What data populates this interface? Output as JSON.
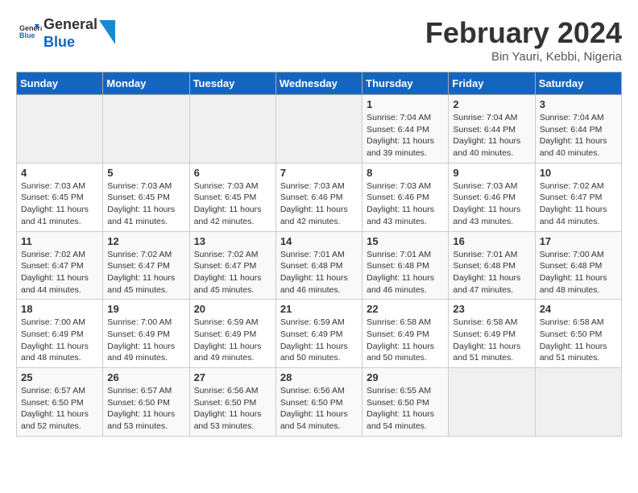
{
  "header": {
    "logo_general": "General",
    "logo_blue": "Blue",
    "month_title": "February 2024",
    "location": "Bin Yauri, Kebbi, Nigeria"
  },
  "weekdays": [
    "Sunday",
    "Monday",
    "Tuesday",
    "Wednesday",
    "Thursday",
    "Friday",
    "Saturday"
  ],
  "weeks": [
    [
      {
        "day": "",
        "sunrise": "",
        "sunset": "",
        "daylight": ""
      },
      {
        "day": "",
        "sunrise": "",
        "sunset": "",
        "daylight": ""
      },
      {
        "day": "",
        "sunrise": "",
        "sunset": "",
        "daylight": ""
      },
      {
        "day": "",
        "sunrise": "",
        "sunset": "",
        "daylight": ""
      },
      {
        "day": "1",
        "sunrise": "Sunrise: 7:04 AM",
        "sunset": "Sunset: 6:44 PM",
        "daylight": "Daylight: 11 hours and 39 minutes."
      },
      {
        "day": "2",
        "sunrise": "Sunrise: 7:04 AM",
        "sunset": "Sunset: 6:44 PM",
        "daylight": "Daylight: 11 hours and 40 minutes."
      },
      {
        "day": "3",
        "sunrise": "Sunrise: 7:04 AM",
        "sunset": "Sunset: 6:44 PM",
        "daylight": "Daylight: 11 hours and 40 minutes."
      }
    ],
    [
      {
        "day": "4",
        "sunrise": "Sunrise: 7:03 AM",
        "sunset": "Sunset: 6:45 PM",
        "daylight": "Daylight: 11 hours and 41 minutes."
      },
      {
        "day": "5",
        "sunrise": "Sunrise: 7:03 AM",
        "sunset": "Sunset: 6:45 PM",
        "daylight": "Daylight: 11 hours and 41 minutes."
      },
      {
        "day": "6",
        "sunrise": "Sunrise: 7:03 AM",
        "sunset": "Sunset: 6:45 PM",
        "daylight": "Daylight: 11 hours and 42 minutes."
      },
      {
        "day": "7",
        "sunrise": "Sunrise: 7:03 AM",
        "sunset": "Sunset: 6:46 PM",
        "daylight": "Daylight: 11 hours and 42 minutes."
      },
      {
        "day": "8",
        "sunrise": "Sunrise: 7:03 AM",
        "sunset": "Sunset: 6:46 PM",
        "daylight": "Daylight: 11 hours and 43 minutes."
      },
      {
        "day": "9",
        "sunrise": "Sunrise: 7:03 AM",
        "sunset": "Sunset: 6:46 PM",
        "daylight": "Daylight: 11 hours and 43 minutes."
      },
      {
        "day": "10",
        "sunrise": "Sunrise: 7:02 AM",
        "sunset": "Sunset: 6:47 PM",
        "daylight": "Daylight: 11 hours and 44 minutes."
      }
    ],
    [
      {
        "day": "11",
        "sunrise": "Sunrise: 7:02 AM",
        "sunset": "Sunset: 6:47 PM",
        "daylight": "Daylight: 11 hours and 44 minutes."
      },
      {
        "day": "12",
        "sunrise": "Sunrise: 7:02 AM",
        "sunset": "Sunset: 6:47 PM",
        "daylight": "Daylight: 11 hours and 45 minutes."
      },
      {
        "day": "13",
        "sunrise": "Sunrise: 7:02 AM",
        "sunset": "Sunset: 6:47 PM",
        "daylight": "Daylight: 11 hours and 45 minutes."
      },
      {
        "day": "14",
        "sunrise": "Sunrise: 7:01 AM",
        "sunset": "Sunset: 6:48 PM",
        "daylight": "Daylight: 11 hours and 46 minutes."
      },
      {
        "day": "15",
        "sunrise": "Sunrise: 7:01 AM",
        "sunset": "Sunset: 6:48 PM",
        "daylight": "Daylight: 11 hours and 46 minutes."
      },
      {
        "day": "16",
        "sunrise": "Sunrise: 7:01 AM",
        "sunset": "Sunset: 6:48 PM",
        "daylight": "Daylight: 11 hours and 47 minutes."
      },
      {
        "day": "17",
        "sunrise": "Sunrise: 7:00 AM",
        "sunset": "Sunset: 6:48 PM",
        "daylight": "Daylight: 11 hours and 48 minutes."
      }
    ],
    [
      {
        "day": "18",
        "sunrise": "Sunrise: 7:00 AM",
        "sunset": "Sunset: 6:49 PM",
        "daylight": "Daylight: 11 hours and 48 minutes."
      },
      {
        "day": "19",
        "sunrise": "Sunrise: 7:00 AM",
        "sunset": "Sunset: 6:49 PM",
        "daylight": "Daylight: 11 hours and 49 minutes."
      },
      {
        "day": "20",
        "sunrise": "Sunrise: 6:59 AM",
        "sunset": "Sunset: 6:49 PM",
        "daylight": "Daylight: 11 hours and 49 minutes."
      },
      {
        "day": "21",
        "sunrise": "Sunrise: 6:59 AM",
        "sunset": "Sunset: 6:49 PM",
        "daylight": "Daylight: 11 hours and 50 minutes."
      },
      {
        "day": "22",
        "sunrise": "Sunrise: 6:58 AM",
        "sunset": "Sunset: 6:49 PM",
        "daylight": "Daylight: 11 hours and 50 minutes."
      },
      {
        "day": "23",
        "sunrise": "Sunrise: 6:58 AM",
        "sunset": "Sunset: 6:49 PM",
        "daylight": "Daylight: 11 hours and 51 minutes."
      },
      {
        "day": "24",
        "sunrise": "Sunrise: 6:58 AM",
        "sunset": "Sunset: 6:50 PM",
        "daylight": "Daylight: 11 hours and 51 minutes."
      }
    ],
    [
      {
        "day": "25",
        "sunrise": "Sunrise: 6:57 AM",
        "sunset": "Sunset: 6:50 PM",
        "daylight": "Daylight: 11 hours and 52 minutes."
      },
      {
        "day": "26",
        "sunrise": "Sunrise: 6:57 AM",
        "sunset": "Sunset: 6:50 PM",
        "daylight": "Daylight: 11 hours and 53 minutes."
      },
      {
        "day": "27",
        "sunrise": "Sunrise: 6:56 AM",
        "sunset": "Sunset: 6:50 PM",
        "daylight": "Daylight: 11 hours and 53 minutes."
      },
      {
        "day": "28",
        "sunrise": "Sunrise: 6:56 AM",
        "sunset": "Sunset: 6:50 PM",
        "daylight": "Daylight: 11 hours and 54 minutes."
      },
      {
        "day": "29",
        "sunrise": "Sunrise: 6:55 AM",
        "sunset": "Sunset: 6:50 PM",
        "daylight": "Daylight: 11 hours and 54 minutes."
      },
      {
        "day": "",
        "sunrise": "",
        "sunset": "",
        "daylight": ""
      },
      {
        "day": "",
        "sunrise": "",
        "sunset": "",
        "daylight": ""
      }
    ]
  ]
}
